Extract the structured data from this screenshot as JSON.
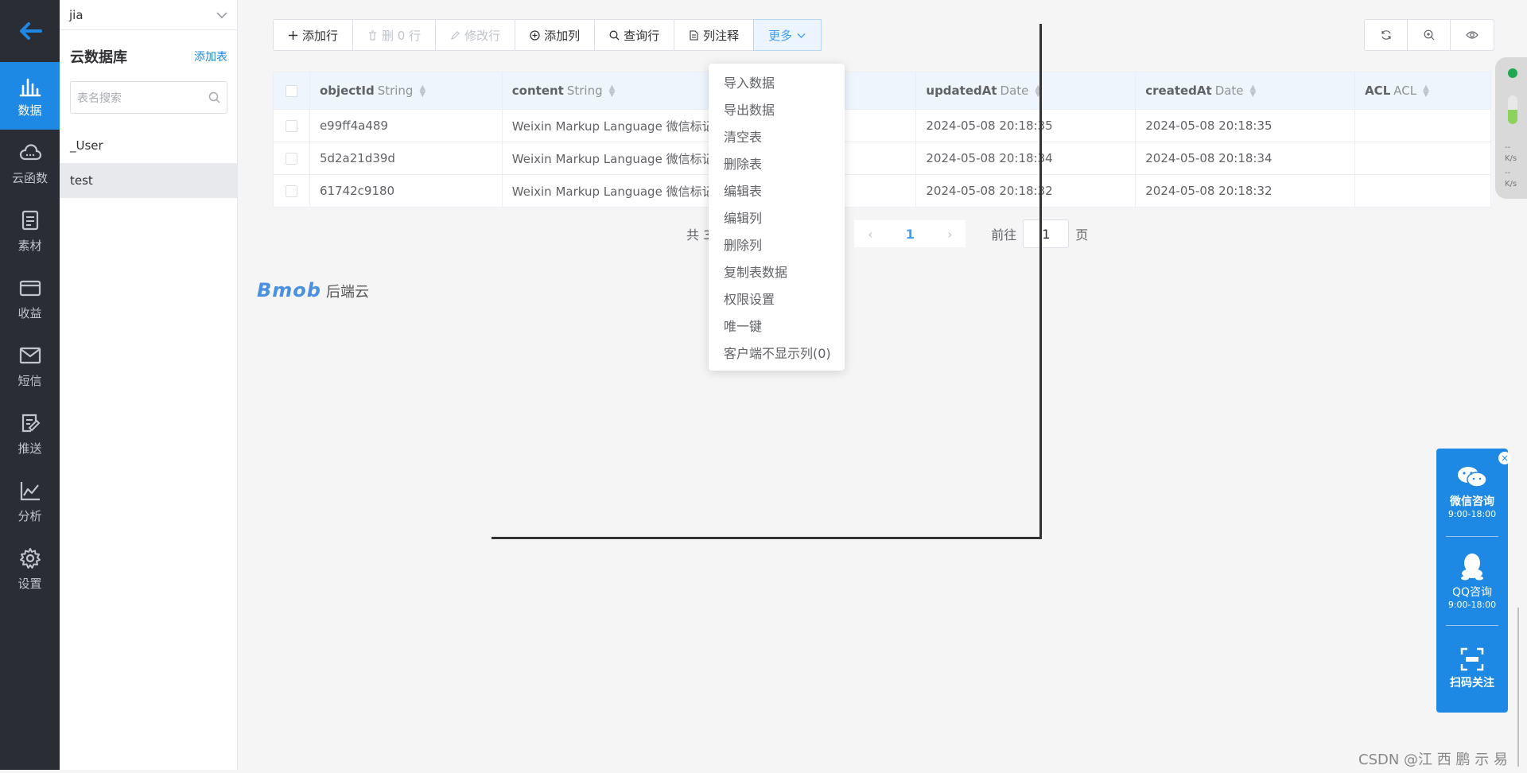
{
  "nav": {
    "items": [
      {
        "label": "数据",
        "icon": "bar-chart-icon"
      },
      {
        "label": "云函数",
        "icon": "cloud-icon"
      },
      {
        "label": "素材",
        "icon": "document-icon"
      },
      {
        "label": "收益",
        "icon": "card-icon"
      },
      {
        "label": "短信",
        "icon": "mail-icon"
      },
      {
        "label": "推送",
        "icon": "push-icon"
      },
      {
        "label": "分析",
        "icon": "line-chart-icon"
      },
      {
        "label": "设置",
        "icon": "gear-icon"
      }
    ]
  },
  "sidebar": {
    "app_name": "jia",
    "title": "云数据库",
    "add_table": "添加表",
    "search_placeholder": "表名搜索",
    "tables": [
      "_User",
      "test"
    ]
  },
  "toolbar": {
    "add_row": "添加行",
    "delete_row": "删 0 行",
    "edit_row": "修改行",
    "add_col": "添加列",
    "query_row": "查询行",
    "col_note": "列注释",
    "more": "更多"
  },
  "table": {
    "columns": [
      {
        "name": "objectId",
        "type": "String"
      },
      {
        "name": "content",
        "type": "String"
      },
      {
        "name": "updatedAt",
        "type": "Date"
      },
      {
        "name": "createdAt",
        "type": "Date"
      },
      {
        "name": "ACL",
        "type": "ACL"
      }
    ],
    "rows": [
      {
        "objectId": "e99ff4a489",
        "content": "Weixin Markup Language 微信标记...",
        "updatedAt": "2024-05-08 20:18:35",
        "createdAt": "2024-05-08 20:18:35",
        "acl": ""
      },
      {
        "objectId": "5d2a21d39d",
        "content": "Weixin Markup Language 微信标记...",
        "updatedAt": "2024-05-08 20:18:34",
        "createdAt": "2024-05-08 20:18:34",
        "acl": ""
      },
      {
        "objectId": "61742c9180",
        "content": "Weixin Markup Language 微信标记...",
        "updatedAt": "2024-05-08 20:18:32",
        "createdAt": "2024-05-08 20:18:32",
        "acl": ""
      }
    ]
  },
  "pagination": {
    "total_text": "共 3",
    "current_page": "1",
    "goto_label": "前往",
    "goto_value": "1",
    "page_suffix": "页"
  },
  "logo": {
    "brand": "Bmob",
    "suffix": "后端云"
  },
  "more_menu": [
    "导入数据",
    "导出数据",
    "清空表",
    "删除表",
    "编辑表",
    "编辑列",
    "删除列",
    "复制表数据",
    "权限设置",
    "唯一键",
    "客户端不显示列(0)"
  ],
  "status": {
    "up": "--",
    "down": "--",
    "unit": "K/s"
  },
  "contact": {
    "wechat_title": "微信咨询",
    "wechat_time": "9:00-18:00",
    "qq_title": "QQ咨询",
    "qq_time": "9:00-18:00",
    "scan_title": "扫码关注"
  },
  "watermark": "CSDN @江 西 鹏 示 易"
}
